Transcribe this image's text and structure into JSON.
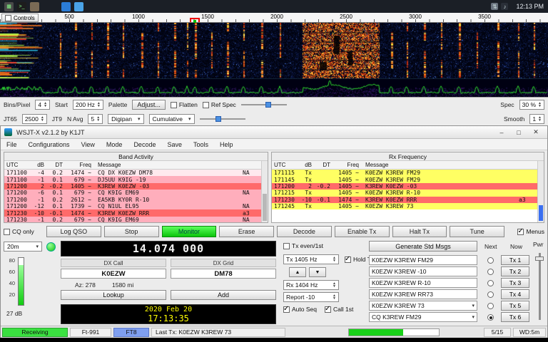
{
  "taskbar": {
    "time": "12:13 PM",
    "icons": [
      {
        "name": "menu-icon",
        "color": "#4a4a4a",
        "glyph": "▦"
      },
      {
        "name": "terminal-icon",
        "color": "#1d1d1d",
        "glyph": ">_"
      },
      {
        "name": "files-icon",
        "color": "#7a6a55",
        "glyph": ""
      },
      {
        "name": "wsjtx-app-icon",
        "color": "#2b7cd6",
        "glyph": ""
      },
      {
        "name": "monitor-app-icon",
        "color": "#4aa3e8",
        "glyph": ""
      }
    ],
    "tray": [
      {
        "name": "network-icon",
        "color": "#6b7480",
        "glyph": "⇅"
      },
      {
        "name": "volume-icon",
        "color": "#2a2f38",
        "glyph": "♪"
      }
    ]
  },
  "wide_graph": {
    "controls_label": "Controls",
    "ticks": [
      "500",
      "1000",
      "1500",
      "2000",
      "2500",
      "3000",
      "3500"
    ],
    "bins_label": "Bins/Pixel",
    "bins_value": "4",
    "start_label": "Start",
    "start_value": "200 Hz",
    "palette_label": "Palette",
    "adjust_label": "Adjust...",
    "flatten_label": "Flatten",
    "ref_label": "Ref Spec",
    "spec_label": "Spec",
    "spec_value": "30 %",
    "jt65_label": "JT65",
    "split_value": "2500",
    "jt9_label": "JT9",
    "navg_label": "N Avg",
    "navg_value": "5",
    "palette_value": "Digipan",
    "display_value": "Cumulative",
    "smooth_label": "Smooth",
    "smooth_value": "1"
  },
  "window": {
    "title": "WSJT-X   v2.1.2   by K1JT",
    "minimize": "–",
    "maximize": "□",
    "close": "✕",
    "menus": [
      "File",
      "Configurations",
      "View",
      "Mode",
      "Decode",
      "Save",
      "Tools",
      "Help"
    ]
  },
  "band_activity": {
    "title": "Band Activity",
    "headers": {
      "utc": "UTC",
      "db": "dB",
      "dt": "DT",
      "freq": "Freq",
      "msg": "Message"
    },
    "rows": [
      {
        "utc": "171100",
        "db": "-4",
        "dt": "0.2",
        "freq": "1474 ~",
        "msg": "CQ DX K0EZW DM78",
        "tail": "NA",
        "color": "pale"
      },
      {
        "utc": "171100",
        "db": "-1",
        "dt": "0.1",
        "freq": "679 ~",
        "msg": "DJ5UU K9IG -19",
        "tail": "",
        "color": "pink"
      },
      {
        "utc": "171200",
        "db": "2",
        "dt": "-0.2",
        "freq": "1405 ~",
        "msg": "K3REW K0EZW -03",
        "tail": "",
        "color": "red"
      },
      {
        "utc": "171200",
        "db": "-6",
        "dt": "0.1",
        "freq": "679 ~",
        "msg": "CQ K9IG EM69",
        "tail": "NA",
        "color": "pink"
      },
      {
        "utc": "171200",
        "db": "-1",
        "dt": "0.2",
        "freq": "2612 ~",
        "msg": "EA5KB KY0R R-10",
        "tail": "",
        "color": "pink"
      },
      {
        "utc": "171200",
        "db": "-12",
        "dt": "0.1",
        "freq": "1739 ~",
        "msg": "CQ N1UL EL95",
        "tail": "NA",
        "color": "pink"
      },
      {
        "utc": "171230",
        "db": "-10",
        "dt": "-0.1",
        "freq": "1474 ~",
        "msg": "K3REW K0EZW RRR",
        "tail": "a3",
        "color": "red"
      },
      {
        "utc": "171230",
        "db": "-1",
        "dt": "0.2",
        "freq": "679 ~",
        "msg": "CQ K9IG EM69",
        "tail": "NA",
        "color": "pink"
      }
    ]
  },
  "rx_frequency": {
    "title": "Rx Frequency",
    "headers": {
      "utc": "UTC",
      "db": "dB",
      "dt": "DT",
      "freq": "Freq",
      "msg": "Message"
    },
    "rows": [
      {
        "utc": "171115",
        "db": "Tx",
        "dt": "",
        "freq": "1405 ~",
        "msg": "K0EZW K3REW FM29",
        "tail": "",
        "color": "yellow"
      },
      {
        "utc": "171145",
        "db": "Tx",
        "dt": "",
        "freq": "1405 ~",
        "msg": "K0EZW K3REW FM29",
        "tail": "",
        "color": "yellow"
      },
      {
        "utc": "171200",
        "db": "2",
        "dt": "-0.2",
        "freq": "1405 ~",
        "msg": "K3REW K0EZW -03",
        "tail": "",
        "color": "red"
      },
      {
        "utc": "171215",
        "db": "Tx",
        "dt": "",
        "freq": "1405 ~",
        "msg": "K0EZW K3REW R-10",
        "tail": "",
        "color": "yellow"
      },
      {
        "utc": "171230",
        "db": "-10",
        "dt": "-0.1",
        "freq": "1474 ~",
        "msg": "K3REW K0EZW RRR",
        "tail": "a3",
        "color": "red"
      },
      {
        "utc": "171245",
        "db": "Tx",
        "dt": "",
        "freq": "1405 ~",
        "msg": "K0EZW K3REW 73",
        "tail": "",
        "color": "yellow"
      }
    ]
  },
  "buttons": {
    "cq_only": "CQ only",
    "log_qso": "Log QSO",
    "stop": "Stop",
    "monitor": "Monitor",
    "erase": "Erase",
    "decode": "Decode",
    "enable_tx": "Enable Tx",
    "halt_tx": "Halt Tx",
    "tune": "Tune",
    "menus": "Menus"
  },
  "controls": {
    "band": "20m",
    "meter_ticks": [
      "80",
      "60",
      "40",
      "20"
    ],
    "meter_db": "27 dB",
    "dial_freq": "14.074 000",
    "dx_call_label": "DX Call",
    "dx_grid_label": "DX Grid",
    "dx_call": "K0EZW",
    "dx_grid": "DM78",
    "az": "Az: 278",
    "dist": "1580 mi",
    "lookup": "Lookup",
    "add": "Add",
    "tx_even": "Tx even/1st",
    "tx_freq": "Tx 1405 Hz",
    "hold_tx": "Hold Tx Freq",
    "rx_freq": "Rx 1404 Hz",
    "report": "Report -10",
    "auto_seq": "Auto Seq",
    "call_1st": "Call 1st",
    "date": "2020 Feb 20",
    "time": "17:13:35",
    "up": "▲",
    "down": "▼"
  },
  "messages": {
    "generate": "Generate Std Msgs",
    "next": "Next",
    "now": "Now",
    "pwr": "Pwr",
    "rows": [
      {
        "text": "K0EZW K3REW FM29",
        "tx": "Tx 1",
        "combo": false,
        "next": false
      },
      {
        "text": "K0EZW K3REW -10",
        "tx": "Tx 2",
        "combo": false,
        "next": false
      },
      {
        "text": "K0EZW K3REW R-10",
        "tx": "Tx 3",
        "combo": false,
        "next": false
      },
      {
        "text": "K0EZW K3REW RR73",
        "tx": "Tx 4",
        "combo": false,
        "next": false
      },
      {
        "text": "K0EZW K3REW 73",
        "tx": "Tx 5",
        "combo": true,
        "next": false
      },
      {
        "text": "CQ K3REW FM29",
        "tx": "Tx 6",
        "combo": true,
        "next": true
      }
    ]
  },
  "checks": {
    "cq_only": false,
    "menus": true,
    "tx_even": false,
    "hold_tx": true,
    "auto_seq": true,
    "call_1st": true,
    "flatten": false,
    "ref_spec": false
  },
  "status": {
    "state": "Receiving",
    "rig": "Ft-991",
    "mode": "FT8",
    "last_tx": "Last Tx:  K0EZW K3REW 73",
    "progress": "5/15",
    "wd": "WD:5m",
    "progress_pct": 60
  },
  "colors": {
    "monitor_green": "#0cc40c",
    "yellow_row": "#ffff63",
    "red_row": "#ff6a6a",
    "pink_row": "#ffaebc",
    "mode_blue": "#7f9ff0",
    "status_green": "#3ae040",
    "waterfall_bg": "#01030f",
    "spectrum_line": "#2fe02f",
    "clock_yellow": "#ffff00"
  }
}
